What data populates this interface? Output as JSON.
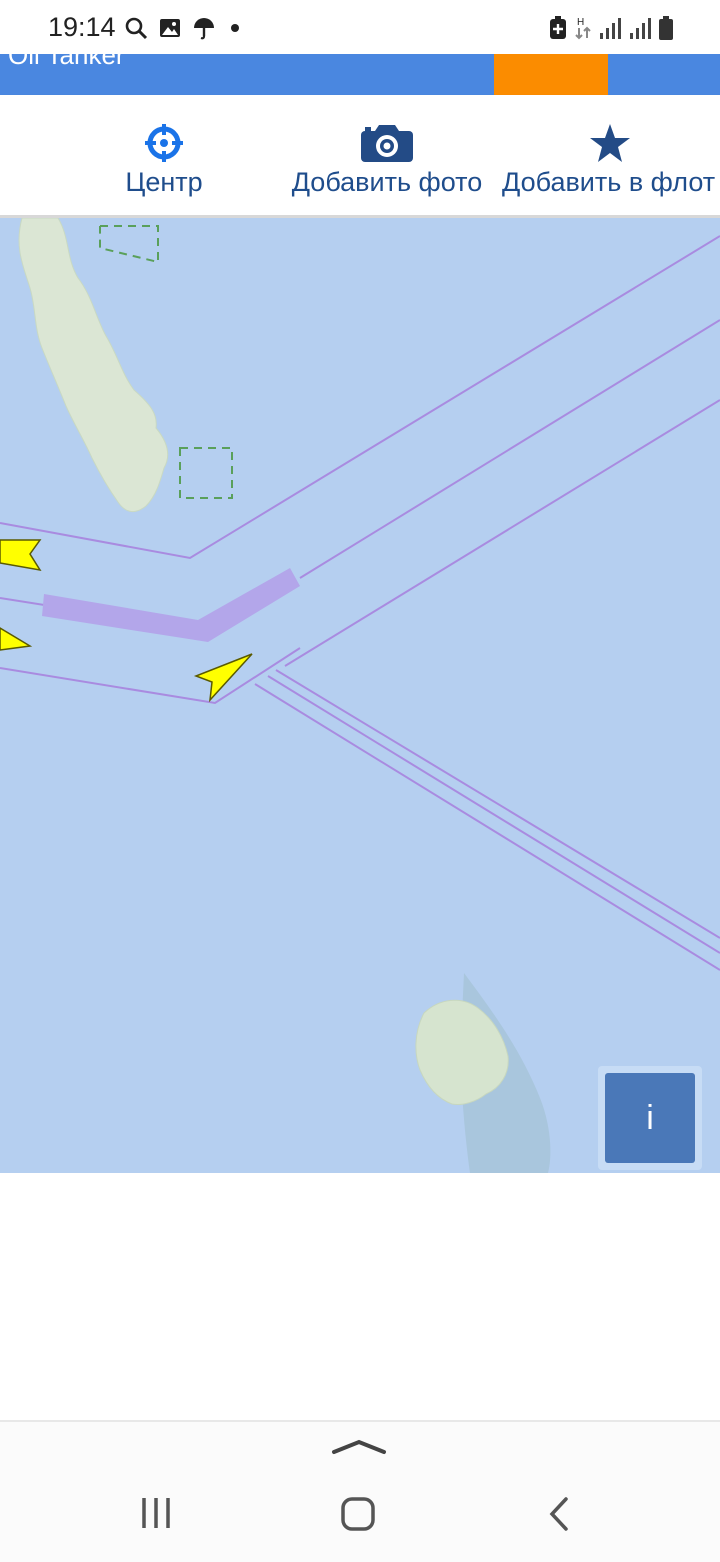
{
  "status_bar": {
    "time": "19:14",
    "left_icons": [
      "search-icon",
      "image-icon",
      "umbrella-icon",
      "dot-icon"
    ],
    "right_icons": [
      "battery-saver-icon",
      "data-arrows-icon",
      "signal-icon",
      "signal-icon",
      "battery-icon"
    ]
  },
  "header": {
    "title": "Oil Tanker",
    "accent_color": "#fb8c00",
    "brand_color": "#4a87e0"
  },
  "actions": [
    {
      "label": "Центр",
      "icon": "crosshair-icon"
    },
    {
      "label": "Добавить фото",
      "icon": "camera-icon"
    },
    {
      "label": "Добавить в флот",
      "icon": "star-icon"
    }
  ],
  "map": {
    "info_button_label": "i",
    "water_color": "#b5cff0",
    "lane_color": "#a98be0",
    "vessel_color": "#ffff00"
  },
  "nav_bar": {
    "icons": [
      "chevron-up-icon",
      "recent-apps-icon",
      "home-icon",
      "back-icon"
    ]
  }
}
